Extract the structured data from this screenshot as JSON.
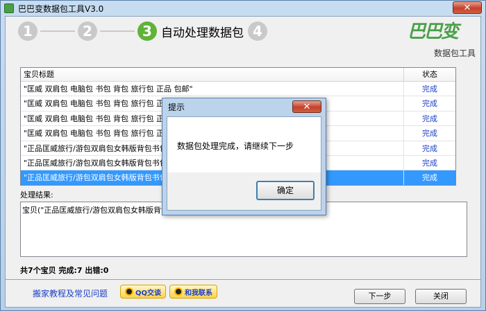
{
  "window": {
    "title": "巴巴变数据包工具V3.0",
    "close_label": "✕"
  },
  "steps": {
    "items": [
      "1",
      "2",
      "3",
      "4"
    ],
    "active_label": "自动处理数据包"
  },
  "logo": {
    "glyph": "巴巴变",
    "subtitle": "数据包工具"
  },
  "table": {
    "headers": {
      "title": "宝贝标题",
      "status": "状态"
    },
    "rows": [
      {
        "title": "\"匡威 双肩包 电脑包 书包 背包 旅行包 正品 包邮\"",
        "status": "完成"
      },
      {
        "title": "\"匡威 双肩包 电脑包 书包 背包 旅行包 正品 包",
        "status": "完成"
      },
      {
        "title": "\"匡威 双肩包 电脑包 书包 背包 旅行包 正品 包",
        "status": "完成"
      },
      {
        "title": "\"匡威 双肩包 电脑包 书包 背包 旅行包 正品 包",
        "status": "完成"
      },
      {
        "title": "\"正品匡威旅行/游包双肩包女韩版背包书包1",
        "status": "完成"
      },
      {
        "title": "\"正品匡威旅行/游包双肩包女韩版背包书包1",
        "status": "完成"
      },
      {
        "title": "\"正品匡威旅行/游包双肩包女韩版背包书包1",
        "status": "完成"
      }
    ]
  },
  "result": {
    "label": "处理结果:",
    "text": "宝贝(\"正品匡威旅行/游包双肩包女韩版背包                                  ):0 出错:0"
  },
  "summary": "共7个宝贝 完成:7 出错:0",
  "footer": {
    "help_link": "搬家教程及常见问题",
    "qq_label": "QQ交谈",
    "contact_label": "和我联系",
    "next_label": "下一步",
    "close_label": "关闭"
  },
  "dialog": {
    "title": "提示",
    "close_label": "✕",
    "message": "数据包处理完成，请继续下一步",
    "ok_label": "确定"
  }
}
